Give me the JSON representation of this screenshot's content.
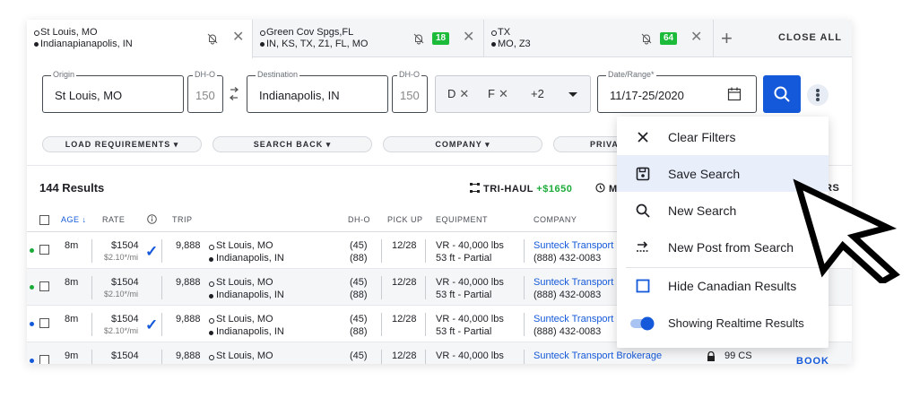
{
  "tabs": [
    {
      "line1": "St Louis, MO",
      "line2": "Indianapianapolis, IN",
      "badge": ""
    },
    {
      "line1": "Green Cov Spgs,FL",
      "line2": "IN, KS, TX, Z1, FL, MO",
      "badge": "18"
    },
    {
      "line1": "TX",
      "line2": "MO, Z3",
      "badge": "64"
    }
  ],
  "tabbar": {
    "close_all": "CLOSE ALL",
    "add": "+",
    "close_glyph": "✕"
  },
  "search": {
    "origin_label": "Origin",
    "origin": "St Louis, MO",
    "dh_label": "DH-O",
    "dh_origin": "150",
    "dest_label": "Destination",
    "destination": "Indianapolis, IN",
    "dh_dest": "150",
    "chips": [
      "D",
      "F"
    ],
    "more": "+2",
    "date_label": "Date/Range*",
    "date": "11/17-25/2020"
  },
  "filters": [
    "LOAD REQUIREMENTS ▾",
    "SEARCH BACK ▾",
    "COMPANY ▾",
    "PRIVA"
  ],
  "results": {
    "count": "144 Results",
    "trihaul_label": "TRI-HAUL",
    "trihaul_amount": "+$1650",
    "clock_frag": "M",
    "right_frag": "RS"
  },
  "columns": {
    "age": "AGE ↓",
    "rate": "RATE",
    "trip": "TRIP",
    "dho": "DH-O",
    "pickup": "PICK UP",
    "equipment": "EQUIPMENT",
    "company": "COMPANY"
  },
  "rows": [
    {
      "age": "8m",
      "rate": "$1504",
      "per_mile": "$2.10*/mi",
      "trip": "9,888",
      "origin": "St Louis, MO",
      "dest": "Indianapolis, IN",
      "dh1": "(45)",
      "dh2": "(88)",
      "pickup": "12/28",
      "equip1": "VR - 40,000 lbs",
      "equip2": "53 ft - Partial",
      "company": "Sunteck Transport",
      "phone": "(888) 432-0083",
      "checked": true,
      "dot": "#1cab3a"
    },
    {
      "age": "8m",
      "rate": "$1504",
      "per_mile": "$2.10*/mi",
      "trip": "9,888",
      "origin": "St Louis, MO",
      "dest": "Indianapolis, IN",
      "dh1": "(45)",
      "dh2": "(88)",
      "pickup": "12/28",
      "equip1": "VR - 40,000 lbs",
      "equip2": "53 ft - Partial",
      "company": "Sunteck Transport",
      "phone": "(888) 432-0083",
      "checked": false,
      "dot": "#1cab3a"
    },
    {
      "age": "8m",
      "rate": "$1504",
      "per_mile": "$2.10*/mi",
      "trip": "9,888",
      "origin": "St Louis, MO",
      "dest": "Indianapolis, IN",
      "dh1": "(45)",
      "dh2": "(88)",
      "pickup": "12/28",
      "equip1": "VR - 40,000 lbs",
      "equip2": "53 ft - Partial",
      "company": "Sunteck Transport",
      "phone": "(888) 432-0083",
      "checked": true,
      "dot": "#1459d9"
    },
    {
      "age": "9m",
      "rate": "$1504",
      "per_mile": "",
      "trip": "9,888",
      "origin": "St Louis, MO",
      "dest": "",
      "dh1": "(45)",
      "dh2": "",
      "pickup": "12/28",
      "equip1": "VR - 40,000 lbs",
      "equip2": "",
      "company": "Sunteck Transport Brokerage",
      "phone": "",
      "checked": false,
      "dot": "#1459d9",
      "cs": "99 CS",
      "book": "BOOK"
    }
  ],
  "menu": {
    "items": [
      {
        "label": "Clear Filters",
        "icon": "close-icon"
      },
      {
        "label": "Save Search",
        "icon": "save-icon"
      },
      {
        "label": "New Search",
        "icon": "search-icon"
      },
      {
        "label": "New Post from Search",
        "icon": "post-icon"
      },
      {
        "label": "Hide Canadian Results",
        "icon": "checkbox-icon"
      },
      {
        "label": "Showing Realtime Results",
        "icon": "toggle-icon"
      }
    ]
  },
  "colors": {
    "accent": "#1459d9",
    "green": "#1cbb3a",
    "highlight": "#e9eefb"
  }
}
